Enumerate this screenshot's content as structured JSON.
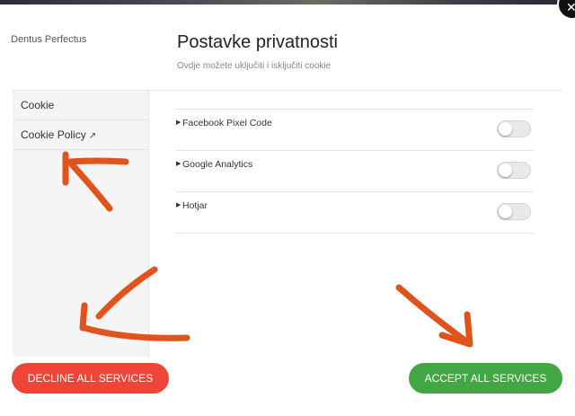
{
  "brand": "Dentus Perfectus",
  "dialog": {
    "title": "Postavke privatnosti",
    "subtitle": "Ovdje možete uključiti i isključiti cookie"
  },
  "sidebar": {
    "items": [
      {
        "label": "Cookie"
      },
      {
        "label": "Cookie Policy",
        "icon": "external-link-icon"
      }
    ]
  },
  "services": [
    {
      "name": "Facebook Pixel Code",
      "enabled": false
    },
    {
      "name": "Google Analytics",
      "enabled": false
    },
    {
      "name": "Hotjar",
      "enabled": false
    }
  ],
  "buttons": {
    "decline": "DECLINE ALL SERVICES",
    "accept": "ACCEPT ALL SERVICES"
  },
  "colors": {
    "decline": "#ef4438",
    "accept": "#43a645",
    "annotation": "#e0531c"
  }
}
